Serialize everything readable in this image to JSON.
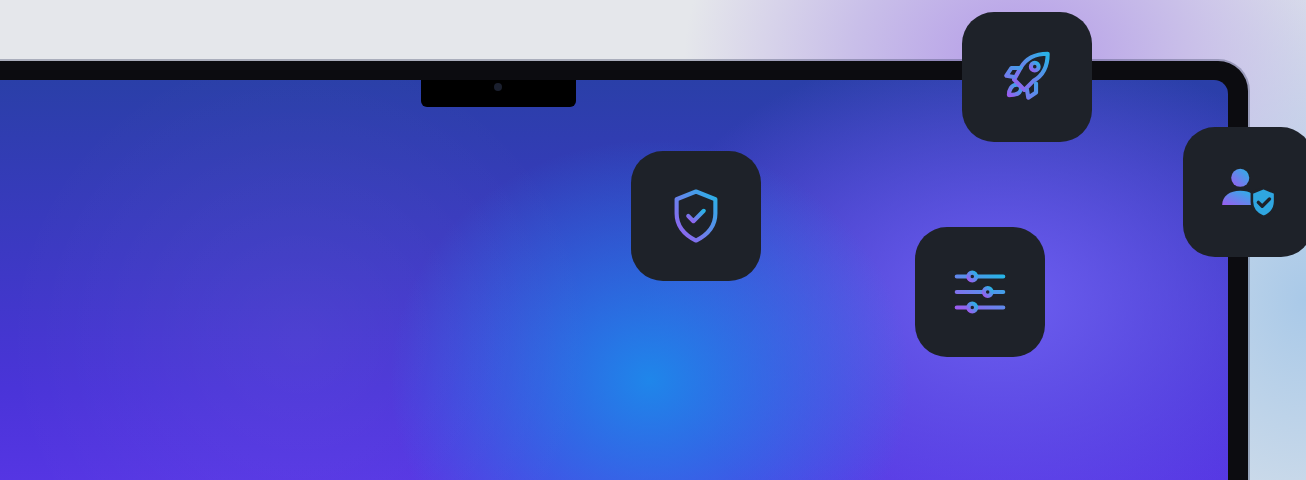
{
  "icon_tiles": [
    {
      "kind": "rocket"
    },
    {
      "kind": "user-shield"
    },
    {
      "kind": "shield-check"
    },
    {
      "kind": "sliders"
    }
  ]
}
